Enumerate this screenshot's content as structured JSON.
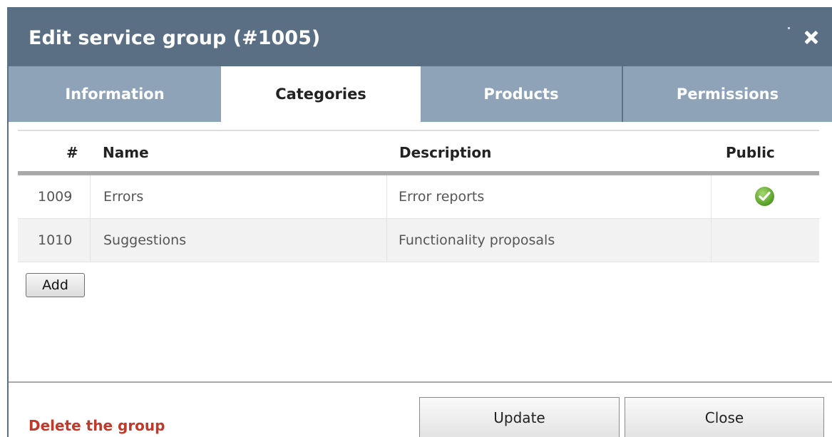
{
  "dialog": {
    "title": "Edit service group (#1005)",
    "close_icon": "close-icon"
  },
  "tabs": [
    {
      "label": "Information",
      "active": false
    },
    {
      "label": "Categories",
      "active": true
    },
    {
      "label": "Products",
      "active": false
    },
    {
      "label": "Permissions",
      "active": false
    }
  ],
  "table": {
    "columns": [
      "#",
      "Name",
      "Description",
      "Public"
    ],
    "rows": [
      {
        "id": "1009",
        "name": "Errors",
        "description": "Error reports",
        "public": true
      },
      {
        "id": "1010",
        "name": "Suggestions",
        "description": "Functionality proposals",
        "public": false
      }
    ]
  },
  "add_label": "Add",
  "footer": {
    "delete_label": "Delete the group",
    "update_label": "Update",
    "close_label": "Close"
  },
  "colors": {
    "titlebar": "#5a6f84",
    "tab_inactive": "#8fa3b8",
    "delete_link": "#c0392b",
    "check_green": "#5ea62f"
  }
}
